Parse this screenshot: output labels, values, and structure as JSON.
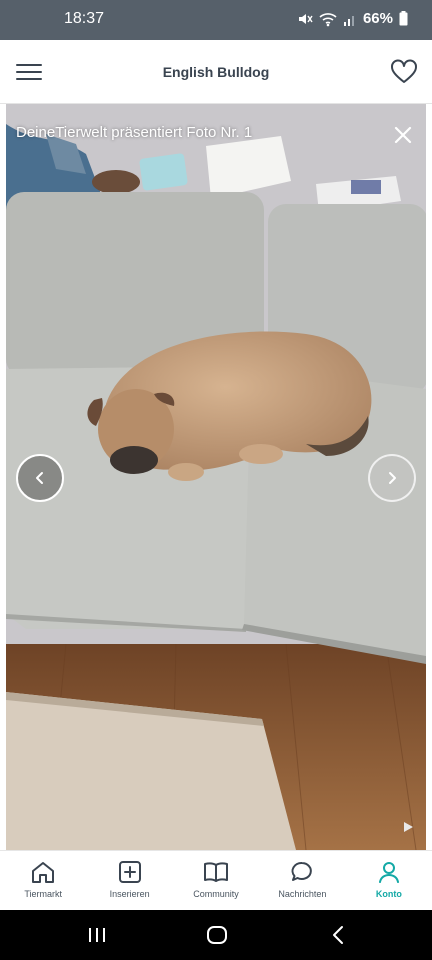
{
  "status_bar": {
    "time": "18:37",
    "battery": "66%",
    "icons": [
      "mute-icon",
      "wifi-icon",
      "signal-icon",
      "battery-icon"
    ]
  },
  "app_bar": {
    "title": "English Bulldog",
    "icons": [
      "menu-icon",
      "heart-icon"
    ]
  },
  "photo_viewer": {
    "caption": "DeineTierwelt präsentiert Foto Nr. 1",
    "icons": [
      "close-icon",
      "chevron-left-icon",
      "chevron-right-icon",
      "play-icon"
    ]
  },
  "bottom_nav": {
    "items": [
      {
        "label": "Tiermarkt",
        "icon": "home-icon"
      },
      {
        "label": "Inserieren",
        "icon": "add-square-icon"
      },
      {
        "label": "Community",
        "icon": "book-icon"
      },
      {
        "label": "Nachrichten",
        "icon": "chat-bubble-icon"
      },
      {
        "label": "Konto",
        "icon": "user-icon"
      }
    ],
    "active": "Konto"
  },
  "system_nav": {
    "icons": [
      "recents-icon",
      "home-circle-icon",
      "back-icon"
    ]
  },
  "colors": {
    "status_bar_bg": "#56606a",
    "accent": "#14a9a6",
    "title_text": "#3a4450"
  }
}
